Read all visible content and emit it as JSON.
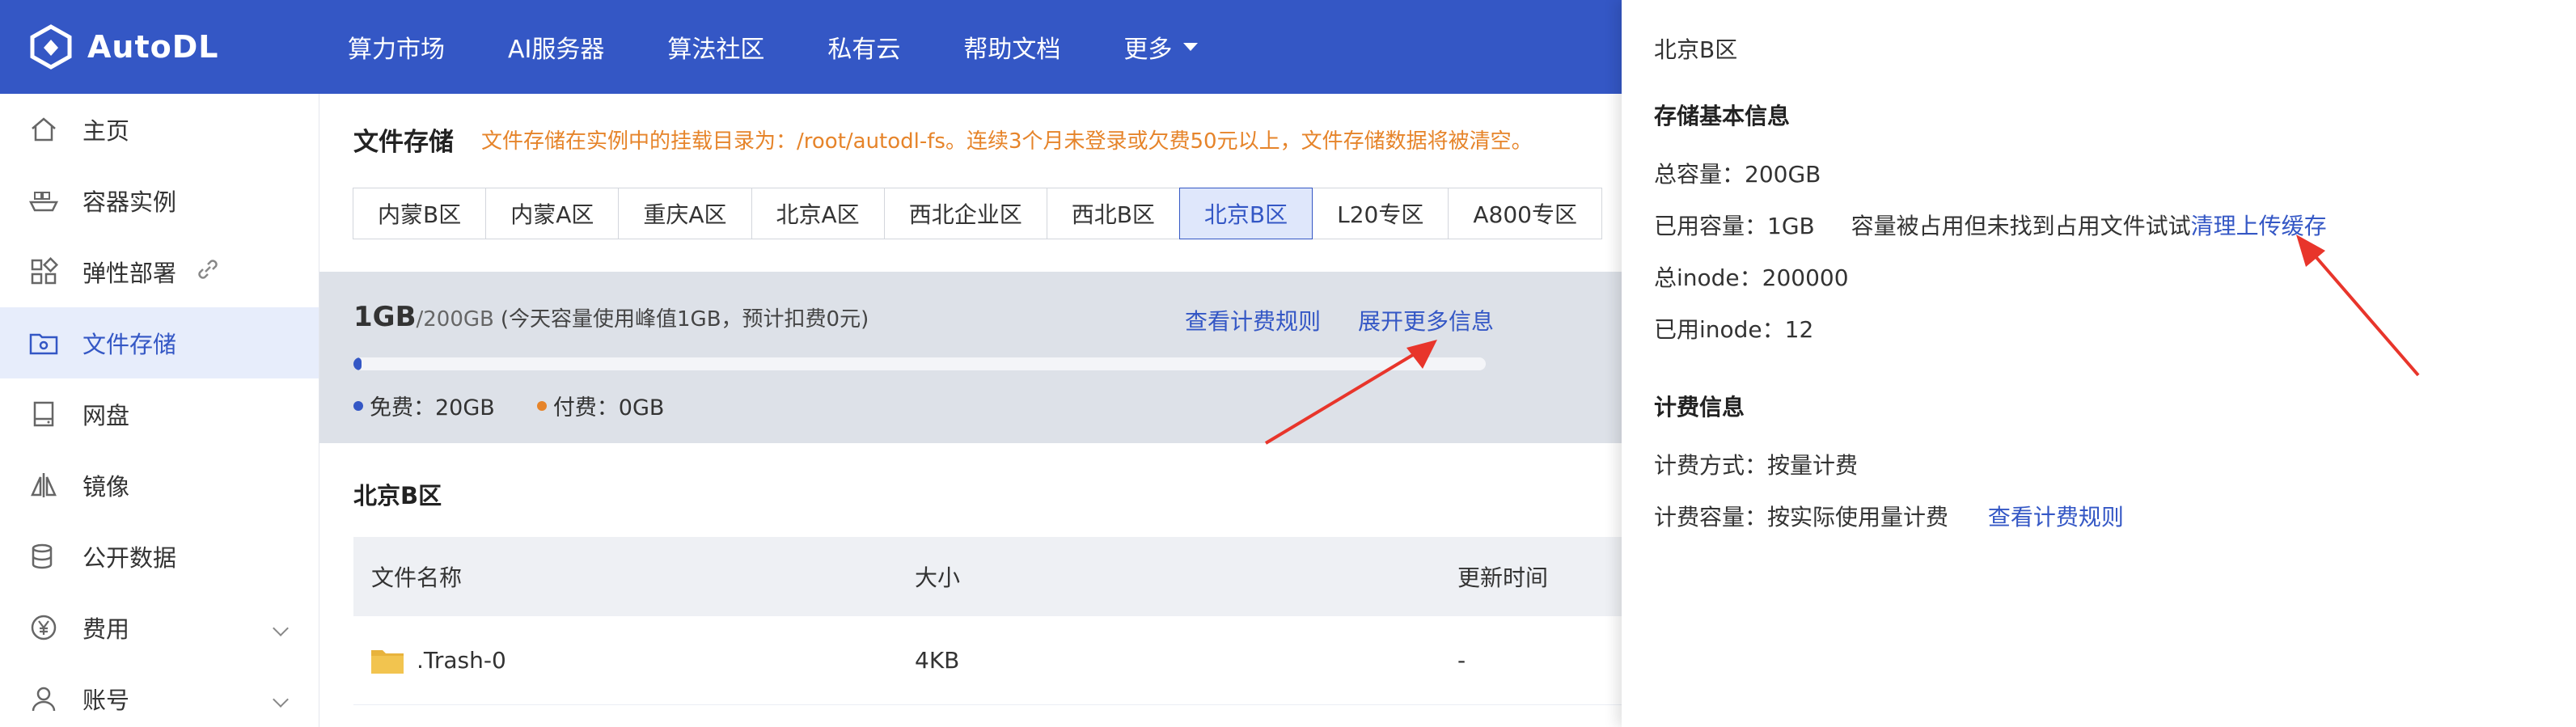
{
  "app": {
    "brand": "AutoDL",
    "nav": [
      "算力市场",
      "AI服务器",
      "算法社区",
      "私有云",
      "帮助文档",
      "更多"
    ]
  },
  "sidebar": {
    "items": [
      {
        "label": "主页"
      },
      {
        "label": "容器实例"
      },
      {
        "label": "弹性部署"
      },
      {
        "label": "文件存储"
      },
      {
        "label": "网盘"
      },
      {
        "label": "镜像"
      },
      {
        "label": "公开数据"
      },
      {
        "label": "费用"
      },
      {
        "label": "账号"
      }
    ]
  },
  "main": {
    "title": "文件存储",
    "warning": "文件存储在实例中的挂载目录为：/root/autodl-fs。连续3个月未登录或欠费50元以上，文件存储数据将被清空。",
    "regions": [
      "内蒙B区",
      "内蒙A区",
      "重庆A区",
      "北京A区",
      "西北企业区",
      "西北B区",
      "北京B区",
      "L20专区",
      "A800专区"
    ],
    "active_region": "北京B区",
    "usage": {
      "used": "1GB",
      "total": "/200GB",
      "note": "(今天容量使用峰值1GB，预计扣费0元)",
      "fraction": 0.005,
      "free_label": "免费：20GB",
      "paid_label": "付费：0GB",
      "billing_link": "查看计费规则",
      "expand_link": "展开更多信息"
    },
    "list_title": "北京B区",
    "table": {
      "headers": [
        "文件名称",
        "大小",
        "更新时间"
      ],
      "rows": [
        {
          "name": ".Trash-0",
          "size": "4KB",
          "updated": "-"
        }
      ]
    }
  },
  "panel": {
    "region": "北京B区",
    "basic_heading": "存储基本信息",
    "total_capacity": "总容量：200GB",
    "used_capacity": "已用容量：1GB",
    "occupied_note": "容量被占用但未找到占用文件试试",
    "clean_link": "清理上传缓存",
    "total_inode": "总inode：200000",
    "used_inode": "已用inode：12",
    "billing_heading": "计费信息",
    "billing_method": "计费方式：按量计费",
    "billing_capacity": "计费容量：按实际使用量计费",
    "billing_link": "查看计费规则"
  },
  "colors": {
    "brand": "#3457c5",
    "warning": "#e6842a",
    "free_dot": "#3457c5",
    "paid_dot": "#e6842a",
    "arrow": "#e8352b"
  }
}
